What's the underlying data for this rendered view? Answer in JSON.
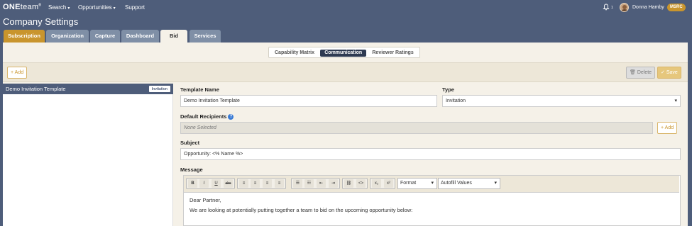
{
  "nav": {
    "brand_bold": "ONE",
    "brand_light": "team",
    "brand_mark": "®",
    "search": "Search",
    "opportunities": "Opportunities",
    "support": "Support",
    "notification_count": "1",
    "user_name": "Donna Hamby",
    "org_badge": "MSRC"
  },
  "page": {
    "title": "Company Settings"
  },
  "main_tabs": [
    {
      "label": "Subscription"
    },
    {
      "label": "Organization"
    },
    {
      "label": "Capture"
    },
    {
      "label": "Dashboard"
    },
    {
      "label": "Bid"
    },
    {
      "label": "Services"
    }
  ],
  "sub_tabs": [
    {
      "label": "Capability Matrix"
    },
    {
      "label": "Communication"
    },
    {
      "label": "Reviewer Ratings"
    }
  ],
  "toolbar": {
    "add_label": "+ Add",
    "delete_label": "Delete",
    "save_label": "Save"
  },
  "templates": [
    {
      "name": "Demo Invitation Template",
      "type_badge": "Invitation"
    }
  ],
  "form": {
    "template_name_label": "Template Name",
    "template_name_value": "Demo Invitation Template",
    "type_label": "Type",
    "type_value": "Invitation",
    "default_recipients_label": "Default Recipients",
    "recipients_value": "None Selected",
    "recipients_add": "+ Add",
    "subject_label": "Subject",
    "subject_value": "Opportunity: <% Name %>",
    "message_label": "Message",
    "format_select": "Format",
    "autofill_select": "Autofill Values",
    "message_line1": "Dear Partner,",
    "message_line2": "We are looking at potentially putting together a team to bid on the upcoming opportunity below:"
  },
  "editor_buttons": {
    "bold": "B",
    "italic": "I",
    "underline": "U",
    "strike": "abc",
    "subscript": "x₂",
    "superscript": "x²"
  },
  "colors": {
    "nav_bg": "#4e5d7a",
    "accent": "#c9952d",
    "panel_bg": "#f5f1e8"
  }
}
